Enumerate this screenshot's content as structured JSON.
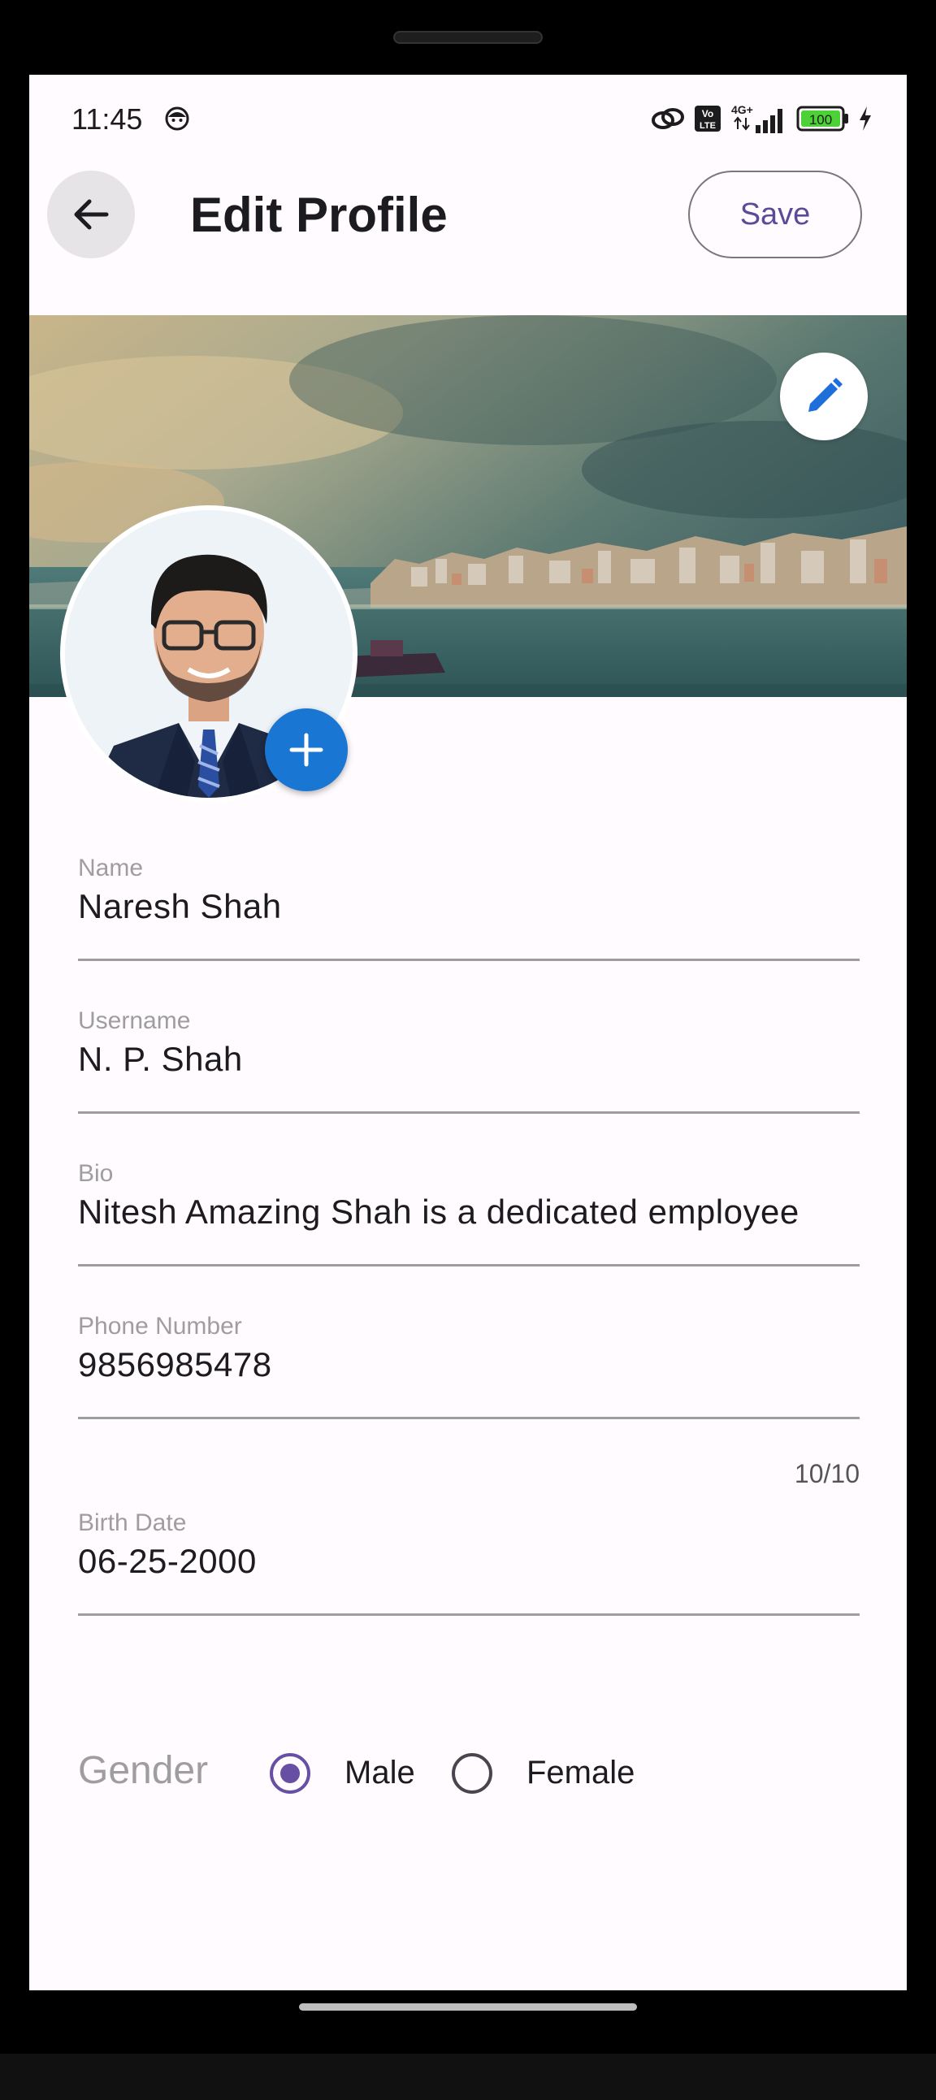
{
  "status_bar": {
    "time": "11:45",
    "network": "4G+",
    "volte": "Vo LTE",
    "battery": "100"
  },
  "app_bar": {
    "title": "Edit Profile",
    "save_label": "Save"
  },
  "form": {
    "name": {
      "label": "Name",
      "value": "Naresh Shah"
    },
    "username": {
      "label": "Username",
      "value": "N. P. Shah"
    },
    "bio": {
      "label": "Bio",
      "value": "Nitesh Amazing Shah is a dedicated employee"
    },
    "phone": {
      "label": "Phone Number",
      "value": "9856985478",
      "counter": "10/10"
    },
    "birth_date": {
      "label": "Birth Date",
      "value": "06-25-2000"
    },
    "gender": {
      "label": "Gender",
      "options": [
        "Male",
        "Female"
      ],
      "selected": "Male"
    }
  },
  "colors": {
    "accent": "#6750a4",
    "fab_blue": "#1976d2",
    "edit_icon_blue": "#1e6fd9",
    "background": "#fffbfe"
  },
  "icons": {
    "back": "arrow-left-icon",
    "cover_edit": "pencil-icon",
    "avatar_add": "plus-icon"
  }
}
